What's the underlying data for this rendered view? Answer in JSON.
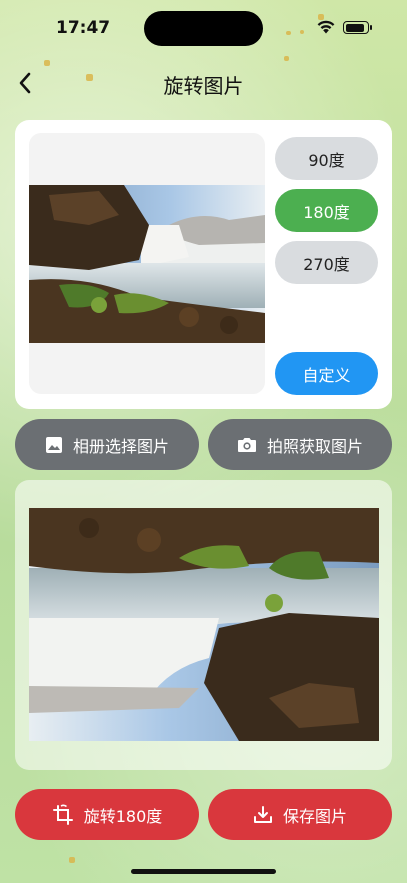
{
  "status": {
    "time": "17:47"
  },
  "header": {
    "title": "旋转图片"
  },
  "rotation_options": [
    {
      "label": "90度",
      "selected": false
    },
    {
      "label": "180度",
      "selected": true
    },
    {
      "label": "270度",
      "selected": false
    }
  ],
  "custom_label": "自定义",
  "source_buttons": {
    "album": "相册选择图片",
    "camera": "拍照获取图片"
  },
  "bottom_buttons": {
    "rotate": "旋转180度",
    "save": "保存图片"
  },
  "colors": {
    "accent_green": "#4caf50",
    "accent_blue": "#2196f3",
    "accent_red": "#d9373d",
    "button_gray": "#6b6f73"
  },
  "icons": {
    "back": "chevron-left-icon",
    "album": "image-icon",
    "camera": "camera-icon",
    "rotate": "rotate-icon",
    "save": "download-icon"
  }
}
